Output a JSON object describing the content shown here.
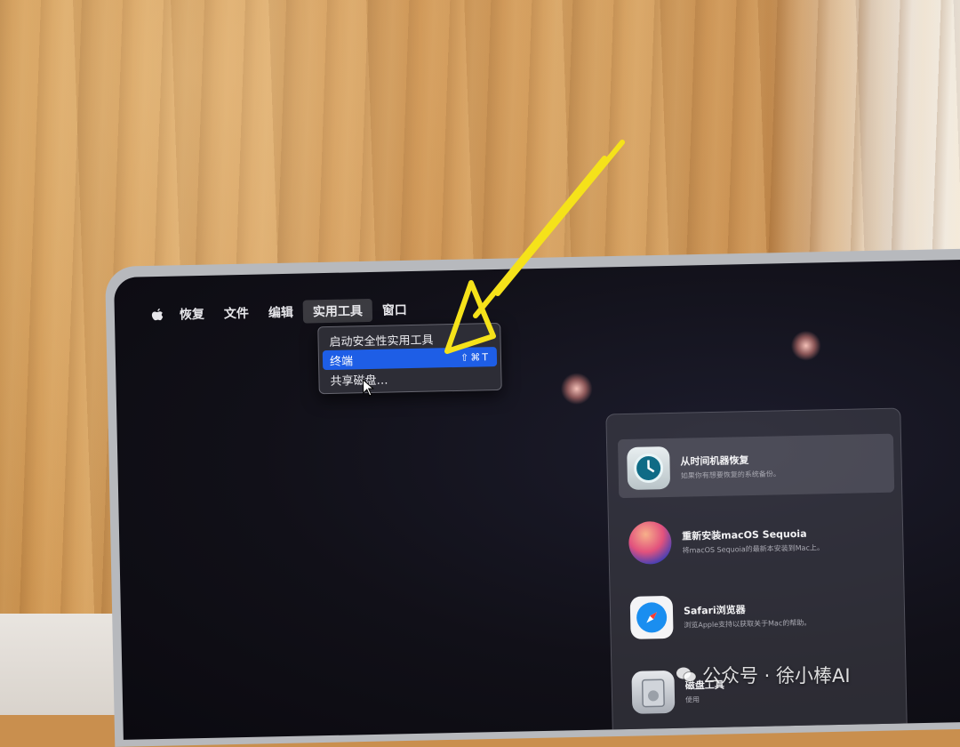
{
  "menubar": {
    "items": [
      "恢复",
      "文件",
      "编辑",
      "实用工具",
      "窗口"
    ]
  },
  "dropdown": {
    "items": [
      {
        "label": "启动安全性实用工具",
        "shortcut": ""
      },
      {
        "label": "终端",
        "shortcut": "⇧⌘T"
      },
      {
        "label": "共享磁盘…",
        "shortcut": ""
      }
    ]
  },
  "recovery_options": [
    {
      "title": "从时间机器恢复",
      "desc": "如果你有想要恢复的系统备份。",
      "icon": "time-machine-icon"
    },
    {
      "title": "重新安装macOS Sequoia",
      "desc": "将macOS Sequoia的最新本安装到Mac上。",
      "icon": "macos-sequoia-icon"
    },
    {
      "title": "Safari浏览器",
      "desc": "浏览Apple支持以获取关于Mac的帮助。",
      "icon": "safari-icon"
    },
    {
      "title": "磁盘工具",
      "desc": "使用",
      "icon": "disk-utility-icon"
    }
  ],
  "watermark": {
    "text": "公众号 · 徐小棒AI"
  },
  "colors": {
    "menu_highlight": "#1e5ee6",
    "annotation_arrow": "#f5e21a"
  }
}
